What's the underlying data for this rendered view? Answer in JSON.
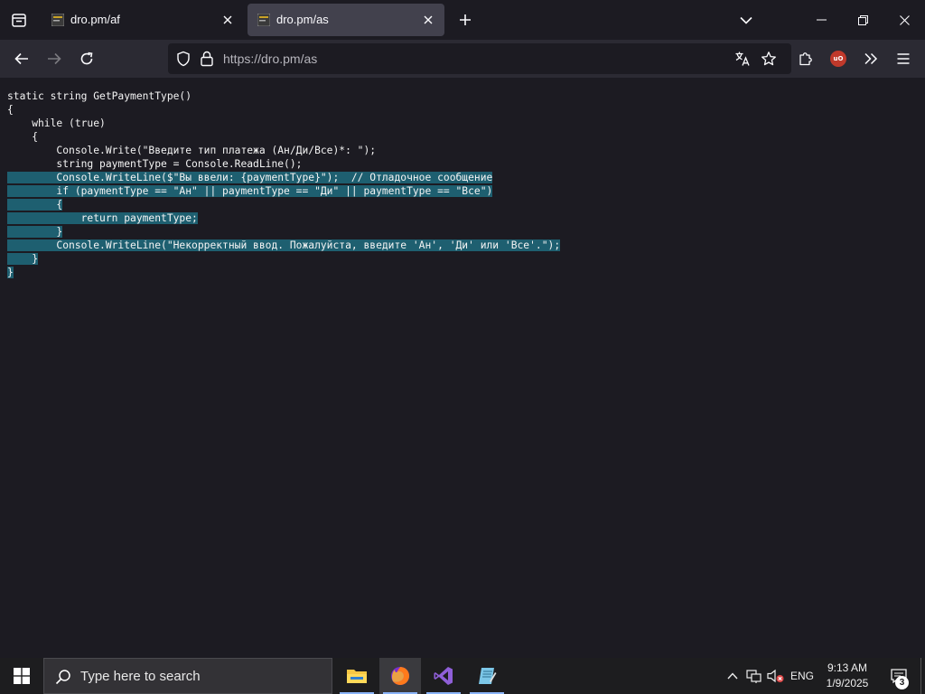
{
  "browser": {
    "tabs": [
      {
        "title": "dro.pm/af",
        "active": false
      },
      {
        "title": "dro.pm/as",
        "active": true
      }
    ],
    "url": "https://dro.pm/as",
    "icons": {
      "tab_list": "tab-list-icon",
      "new_tab": "plus-icon",
      "dropdown": "chevron-down-icon",
      "back": "arrow-left-icon",
      "forward": "arrow-right-icon",
      "reload": "reload-icon",
      "shield": "shield-icon",
      "lock": "lock-icon",
      "translate": "translate-icon",
      "bookmark": "star-icon",
      "extensions": "puzzle-icon",
      "ublock": "ublock-icon",
      "overflow": "chevrons-right-icon",
      "menu": "hamburger-icon"
    },
    "ublock_badge": "uO"
  },
  "code": {
    "lines": [
      {
        "text": "static string GetPaymentType()",
        "selected": false
      },
      {
        "text": "{",
        "selected": false
      },
      {
        "text": "    while (true)",
        "selected": false
      },
      {
        "text": "    {",
        "selected": false
      },
      {
        "text": "        Console.Write(\"Введите тип платежа (Ан/Ди/Все)*: \");",
        "selected": false
      },
      {
        "text": "        string paymentType = Console.ReadLine();",
        "selected": false
      },
      {
        "text": "        Console.WriteLine($\"Вы ввели: {paymentType}\");  // Отладочное сообщение",
        "selected": true
      },
      {
        "text": "        if (paymentType == \"Ан\" || paymentType == \"Ди\" || paymentType == \"Все\")",
        "selected": true
      },
      {
        "text": "        {",
        "selected": true
      },
      {
        "text": "            return paymentType;",
        "selected": true
      },
      {
        "text": "        }",
        "selected": true
      },
      {
        "text": "        Console.WriteLine(\"Некорректный ввод. Пожалуйста, введите 'Ан', 'Ди' или 'Все'.\");",
        "selected": true
      },
      {
        "text": "    }",
        "selected": true
      },
      {
        "text": "}",
        "selected": true
      }
    ],
    "selection_color": "#1e5f70"
  },
  "taskbar": {
    "search_placeholder": "Type here to search",
    "apps": [
      "file-explorer-icon",
      "firefox-icon",
      "visual-studio-icon",
      "notepad-icon"
    ],
    "active_app": "firefox-icon",
    "language": "ENG",
    "time": "9:13 AM",
    "date": "1/9/2025",
    "notification_count": "3"
  }
}
